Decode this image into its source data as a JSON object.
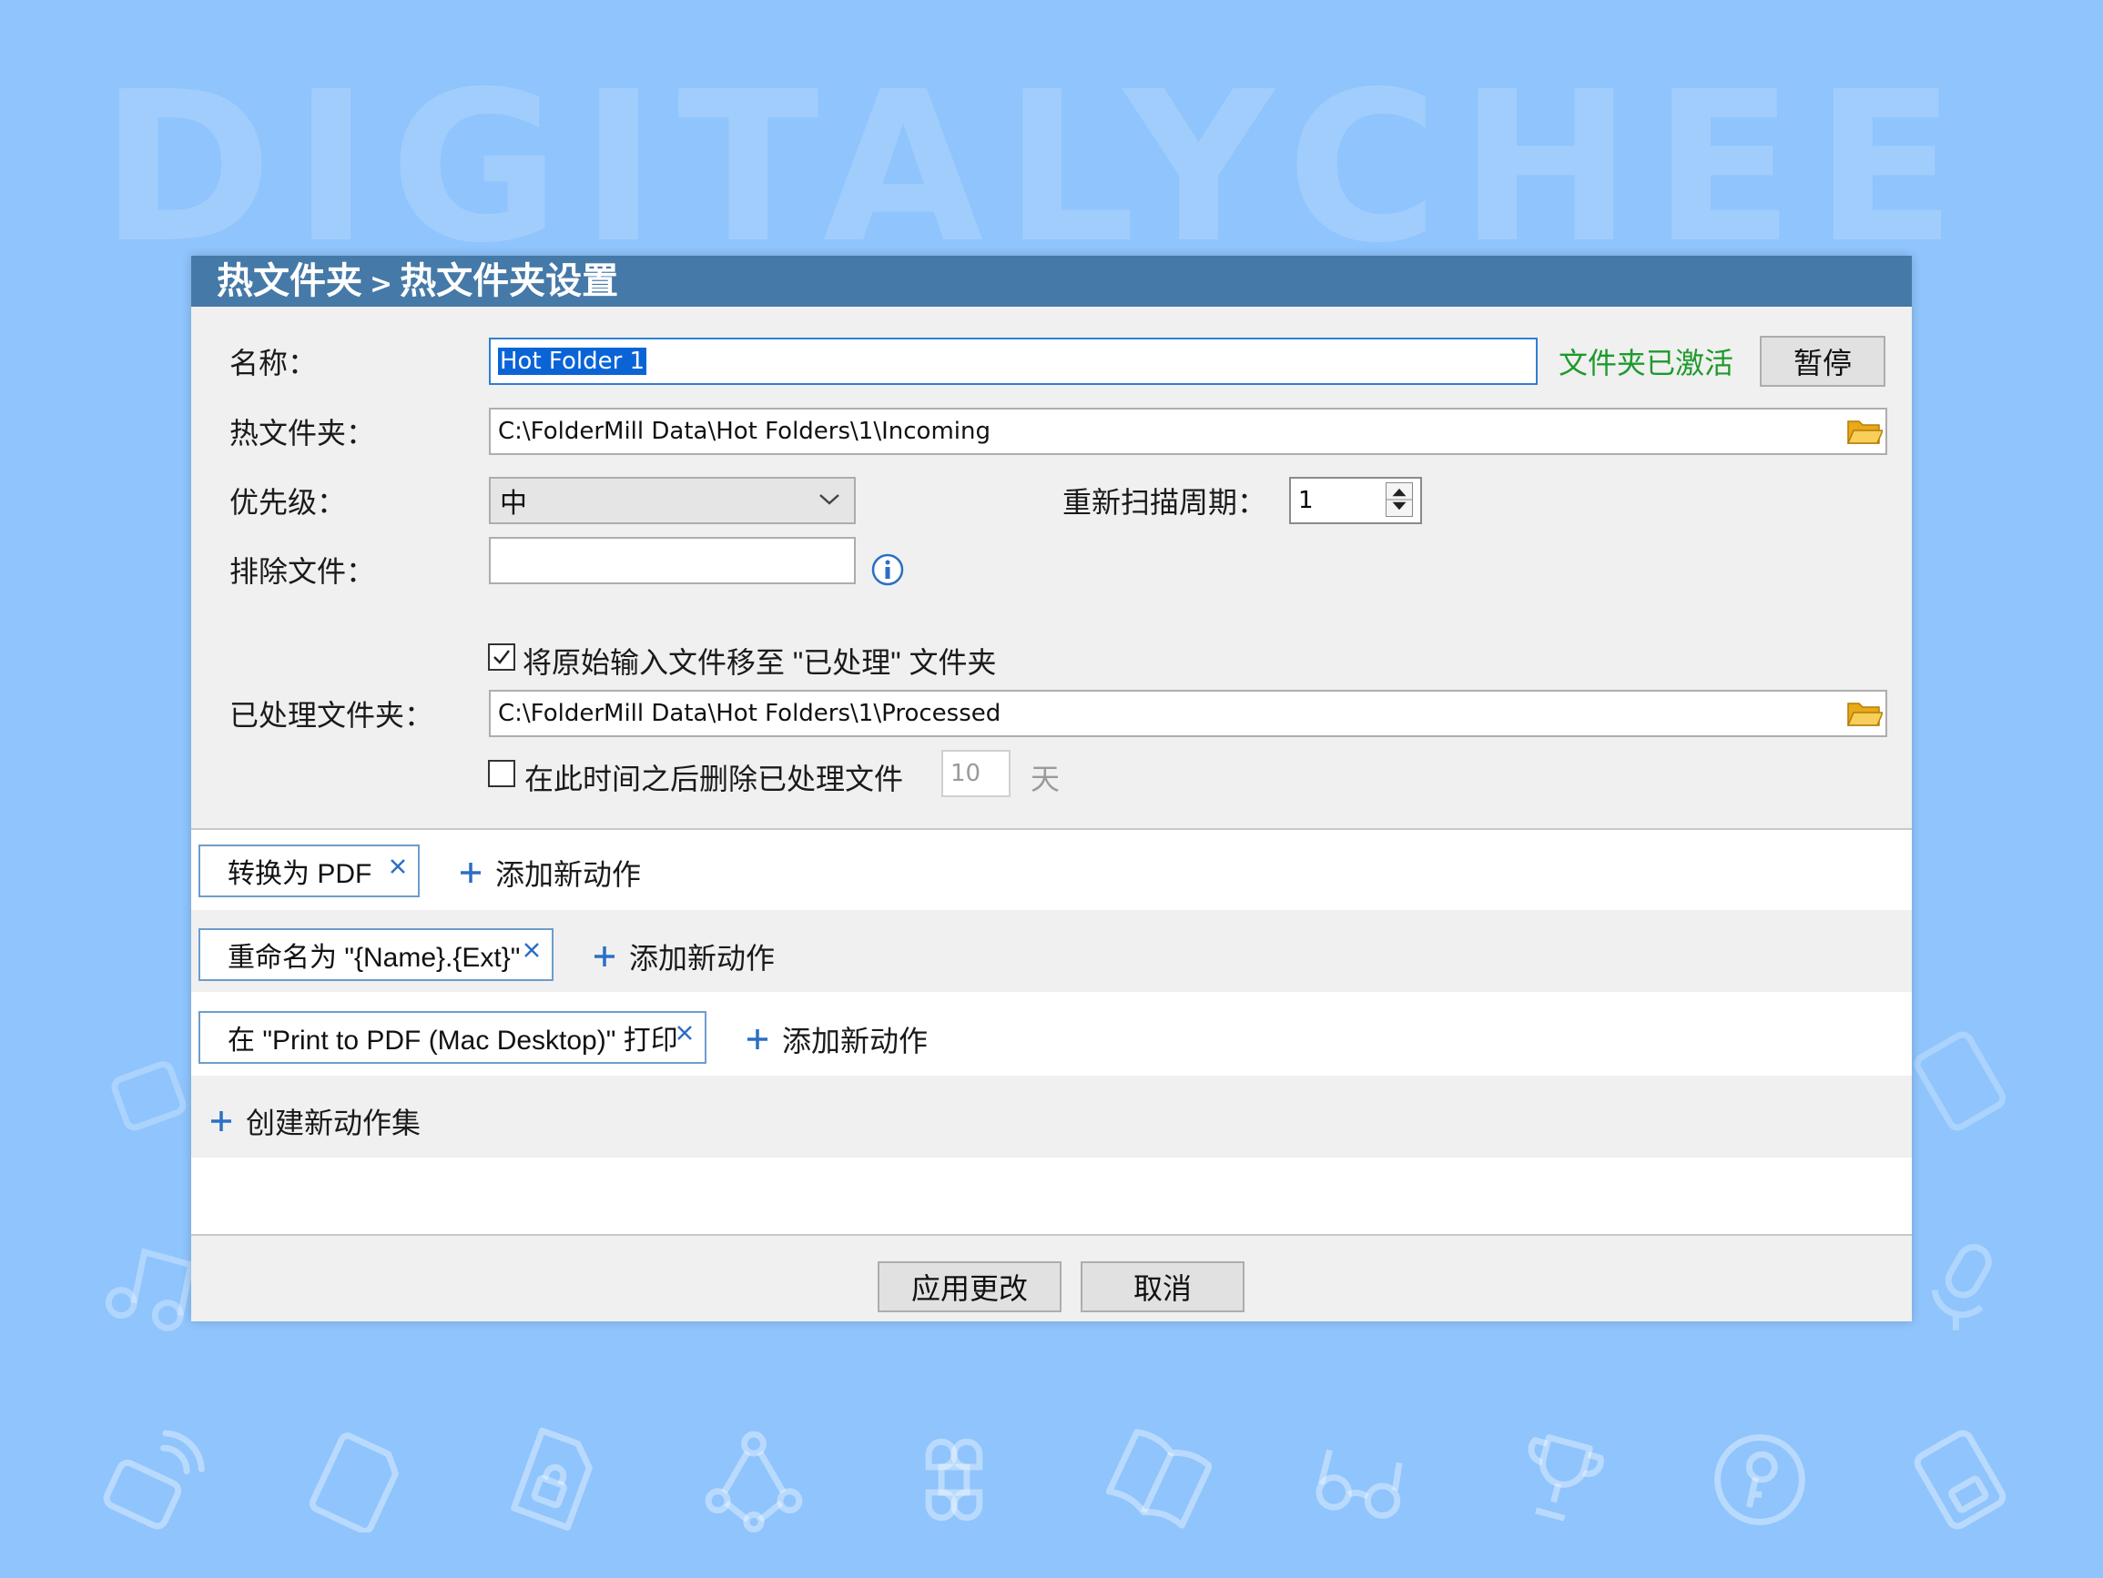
{
  "watermark": "DIGITALYCHEE",
  "window": {
    "breadcrumb_parent": "热文件夹",
    "breadcrumb_sep": ">",
    "breadcrumb_current": "热文件夹设置"
  },
  "form": {
    "name_label": "名称：",
    "name_value": "Hot Folder 1",
    "status_text": "文件夹已激活",
    "pause_label": "暂停",
    "hot_folder_label": "热文件夹：",
    "hot_folder_path": "C:\\FolderMill Data\\Hot Folders\\1\\Incoming",
    "priority_label": "优先级：",
    "priority_value": "中",
    "rescan_label": "重新扫描周期：",
    "rescan_value": "1",
    "exclude_label": "排除文件：",
    "exclude_value": "",
    "move_processed_checked": true,
    "move_processed_label": "将原始输入文件移至 \"已处理\" 文件夹",
    "processed_folder_label": "已处理文件夹：",
    "processed_folder_path": "C:\\FolderMill Data\\Hot Folders\\1\\Processed",
    "delete_after_checked": false,
    "delete_after_label": "在此时间之后删除已处理文件",
    "delete_after_value": "10",
    "delete_after_unit": "天"
  },
  "actions": [
    {
      "label": "转换为 PDF",
      "add_label": "添加新动作"
    },
    {
      "label": "重命名为 \"{Name}.{Ext}\"",
      "add_label": "添加新动作"
    },
    {
      "label": "在 \"Print to PDF (Mac Desktop)\" 打印",
      "add_label": "添加新动作"
    }
  ],
  "create_action_set_label": "创建新动作集",
  "footer": {
    "apply_label": "应用更改",
    "cancel_label": "取消"
  },
  "colors": {
    "background": "#8fc4fc",
    "titlebar": "#4579a8",
    "status_green": "#1e9a2c",
    "chip_border": "#6e9ccc",
    "selection": "#0a64d6"
  },
  "background_icons": [
    "wifi-card-icon",
    "sd-card-icon",
    "file-lock-icon",
    "vector-path-icon",
    "command-key-icon",
    "book-icon",
    "glasses-icon",
    "trophy-icon",
    "key-circle-icon",
    "disk-icon",
    "lock-icon",
    "music-note-icon",
    "microphone-icon"
  ]
}
